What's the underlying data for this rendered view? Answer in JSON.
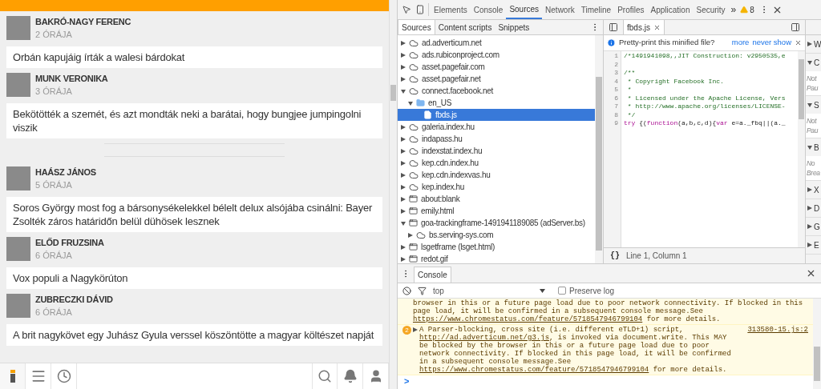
{
  "feed": {
    "articles": [
      {
        "author": "BAKRÓ-NAGY FERENC",
        "time": "2 ÓRÁJA",
        "headline": "Orbán kapujáig írták a walesi bárdokat"
      },
      {
        "author": "MUNK VERONIKA",
        "time": "3 ÓRÁJA",
        "headline": "Bekötötték a szemét, és azt mondták neki a barátai, hogy bungjee jumpingolni viszik",
        "separator_after": true
      },
      {
        "author": "HAÁSZ JÁNOS",
        "time": "5 ÓRÁJA",
        "headline": "Soros György most fog a bársonysékelekkel bélelt delux alsójába csinálni: Bayer Zsolték záros határidőn belül dühösek lesznek"
      },
      {
        "author": "ELŐD FRUZSINA",
        "time": "6 ÓRÁJA",
        "headline": "Vox populi a Nagykörúton"
      },
      {
        "author": "ZUBRECZKI DÁVID",
        "time": "6 ÓRÁJA",
        "headline": "A brit nagykövet egy Juhász Gyula verssel köszöntötte a magyar költészet napját"
      }
    ],
    "bottom_nav": [
      {
        "kind": "logo",
        "selected": true
      },
      {
        "kind": "menu",
        "selected": false
      },
      {
        "kind": "clock",
        "selected": false
      },
      {
        "kind": "spacer"
      },
      {
        "kind": "search",
        "selected": false
      },
      {
        "kind": "bell",
        "selected": false
      },
      {
        "kind": "user",
        "selected": false
      }
    ]
  },
  "devtools": {
    "tabs": [
      {
        "label": "Elements",
        "selected": false
      },
      {
        "label": "Console",
        "selected": false
      },
      {
        "label": "Sources",
        "selected": true
      },
      {
        "label": "Network",
        "selected": false
      },
      {
        "label": "Timeline",
        "selected": false
      },
      {
        "label": "Profiles",
        "selected": false
      },
      {
        "label": "Application",
        "selected": false
      },
      {
        "label": "Security",
        "selected": false
      }
    ],
    "more": "»",
    "warnings": "8",
    "navigator": {
      "tabs": [
        {
          "label": "Sources",
          "selected": true
        },
        {
          "label": "Content scripts",
          "selected": false
        },
        {
          "label": "Snippets",
          "selected": false
        }
      ],
      "tree": [
        {
          "kind": "domain",
          "label": "ad.adverticum.net",
          "expanded": false,
          "selected": false
        },
        {
          "kind": "domain",
          "label": "ads.rubiconproject.com",
          "expanded": false,
          "selected": false
        },
        {
          "kind": "domain",
          "label": "asset.pagefair.com",
          "expanded": false,
          "selected": false
        },
        {
          "kind": "domain",
          "label": "asset.pagefair.net",
          "expanded": false,
          "selected": false
        },
        {
          "kind": "domain",
          "label": "connect.facebook.net",
          "expanded": true,
          "selected": false,
          "children": [
            {
              "kind": "folder",
              "label": "en_US",
              "expanded": true,
              "selected": false,
              "children": [
                {
                  "kind": "file",
                  "label": "fbds.js",
                  "selected": true
                }
              ]
            }
          ]
        },
        {
          "kind": "domain",
          "label": "galeria.index.hu",
          "expanded": false,
          "selected": false
        },
        {
          "kind": "domain",
          "label": "indapass.hu",
          "expanded": false,
          "selected": false
        },
        {
          "kind": "domain",
          "label": "indexstat.index.hu",
          "expanded": false,
          "selected": false
        },
        {
          "kind": "domain",
          "label": "kep.cdn.index.hu",
          "expanded": false,
          "selected": false
        },
        {
          "kind": "domain",
          "label": "kep.cdn.indexvas.hu",
          "expanded": false,
          "selected": false
        },
        {
          "kind": "domain",
          "label": "kep.index.hu",
          "expanded": false,
          "selected": false
        },
        {
          "kind": "frame",
          "label": "about:blank",
          "expanded": false,
          "selected": false
        },
        {
          "kind": "frame",
          "label": "emily.html",
          "expanded": false,
          "selected": false
        },
        {
          "kind": "frame",
          "label": "goa-trackingframe-1491941189085 (adServer.bs)",
          "expanded": true,
          "selected": false,
          "children": [
            {
              "kind": "domain",
              "label": "bs.serving-sys.com",
              "expanded": false,
              "selected": false
            }
          ]
        },
        {
          "kind": "frame",
          "label": "lsgetframe (lsget.html)",
          "expanded": false,
          "selected": false
        },
        {
          "kind": "frame",
          "label": "redot.gif",
          "expanded": false,
          "selected": false
        }
      ]
    },
    "editor": {
      "tab": "fbds.js",
      "infobar": {
        "text": "Pretty-print this minified file?",
        "more": "more",
        "never": "never show"
      },
      "lines": [
        {
          "number": "1",
          "segments": [
            {
              "kind": "comment",
              "text": "/*1491941098,,JIT Construction: v2950535,e"
            }
          ]
        },
        {
          "number": "2"
        },
        {
          "number": "3",
          "segments": [
            {
              "kind": "comment",
              "text": "/**"
            }
          ]
        },
        {
          "number": "4",
          "segments": [
            {
              "kind": "comment",
              "text": " * Copyright Facebook Inc."
            }
          ]
        },
        {
          "number": "5",
          "segments": [
            {
              "kind": "comment",
              "text": " *"
            }
          ]
        },
        {
          "number": "6",
          "segments": [
            {
              "kind": "comment",
              "text": " * Licensed under the Apache License, Vers"
            }
          ]
        },
        {
          "number": "7",
          "segments": [
            {
              "kind": "comment",
              "text": " * http://www.apache.org/licenses/LICENSE-"
            }
          ]
        },
        {
          "number": "8",
          "segments": [
            {
              "kind": "comment",
              "text": " */"
            }
          ]
        },
        {
          "number": "9",
          "segments": [
            {
              "kind": "keyword",
              "text": "try"
            },
            {
              "kind": "plain",
              "text": " {("
            },
            {
              "kind": "keyword",
              "text": "function"
            },
            {
              "kind": "plain",
              "text": "(a,b,c,d){"
            },
            {
              "kind": "keyword",
              "text": "var"
            },
            {
              "kind": "plain",
              "text": " e=a._fbq||(a._"
            }
          ]
        }
      ],
      "pretty_print": "{}",
      "status": "Line 1, Column 1"
    },
    "sidebar": [
      {
        "label": "W",
        "expanded": false
      },
      {
        "label": "C",
        "expanded": true,
        "notes": [
          "Not",
          "Pau"
        ]
      },
      {
        "label": "S",
        "expanded": true,
        "notes": [
          "Not",
          "Pau"
        ]
      },
      {
        "label": "B",
        "expanded": true,
        "notes": [
          "No",
          "Brea"
        ]
      },
      {
        "label": "X",
        "expanded": false
      },
      {
        "label": "D",
        "expanded": false
      },
      {
        "label": "G",
        "expanded": false
      },
      {
        "label": "E",
        "expanded": false
      }
    ],
    "drawer": {
      "tab": "Console",
      "context": "top",
      "preserve_log": {
        "label": "Preserve log",
        "checked": false
      },
      "messages": [
        {
          "parts": [
            {
              "kind": "text",
              "text": "browser in this or a future page load due to poor network connectivity. If blocked in this page load, it will be confirmed in a subsequent console message.See "
            },
            {
              "kind": "link",
              "text": "https://www.chromestatus.com/feature/5718547946799104"
            },
            {
              "kind": "text",
              "text": " for more details."
            }
          ]
        },
        {
          "count": "2",
          "expandable": true,
          "source": "313580-15.js:2",
          "parts": [
            {
              "kind": "text",
              "text": "A Parser-blocking, cross site (i.e. different eTLD+1) script, "
            },
            {
              "kind": "link",
              "text": "http://ad.adverticum.net/g3.js"
            },
            {
              "kind": "text",
              "text": ", is invoked via document.write. This MAY be blocked by the browser in this or a future page load due to poor network connectivity. If blocked in this page load, it will be confirmed in a subsequent console message.See "
            },
            {
              "kind": "link",
              "text": "https://www.chromestatus.com/feature/5718547946799104"
            },
            {
              "kind": "text",
              "text": " for more details."
            }
          ]
        }
      ],
      "prompt": ">"
    }
  }
}
